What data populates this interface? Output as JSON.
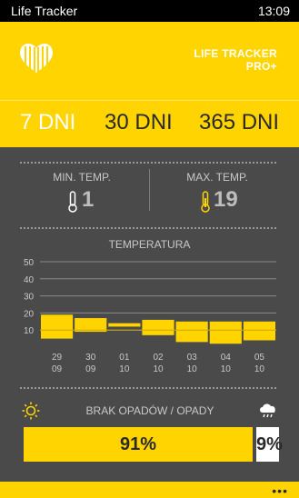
{
  "status": {
    "app_title": "Life Tracker",
    "time": "13:09"
  },
  "header": {
    "app_name_line1": "LIFE TRACKER",
    "app_name_line2": "PRO+"
  },
  "tabs": [
    {
      "label": "7 DNI",
      "active": true
    },
    {
      "label": "30 DNI",
      "active": false
    },
    {
      "label": "365 DNI",
      "active": false
    }
  ],
  "stats": {
    "min_label": "MIN. TEMP.",
    "min_value": "1",
    "max_label": "MAX. TEMP.",
    "max_value": "19"
  },
  "chart_data": {
    "type": "bar",
    "title": "TEMPERATURA",
    "y_ticks": [
      "50",
      "40",
      "30",
      "20",
      "10"
    ],
    "ylim": [
      0,
      50
    ],
    "categories": [
      [
        "29",
        "09"
      ],
      [
        "30",
        "09"
      ],
      [
        "01",
        "10"
      ],
      [
        "02",
        "10"
      ],
      [
        "03",
        "10"
      ],
      [
        "04",
        "10"
      ],
      [
        "05",
        "10"
      ]
    ],
    "series": [
      {
        "lows": [
          5,
          9,
          12,
          7,
          3,
          2,
          4
        ],
        "highs": [
          19,
          17,
          14,
          16,
          15,
          15,
          15
        ]
      }
    ],
    "bar_color": "#ffd400"
  },
  "rain": {
    "title": "BRAK OPADÓW / OPADY",
    "dry_percent": 91,
    "dry_label": "91%",
    "wet_label": "9%"
  },
  "footer": {
    "more": "•••"
  },
  "colors": {
    "accent": "#ffd400",
    "background": "#4a4a4a"
  }
}
